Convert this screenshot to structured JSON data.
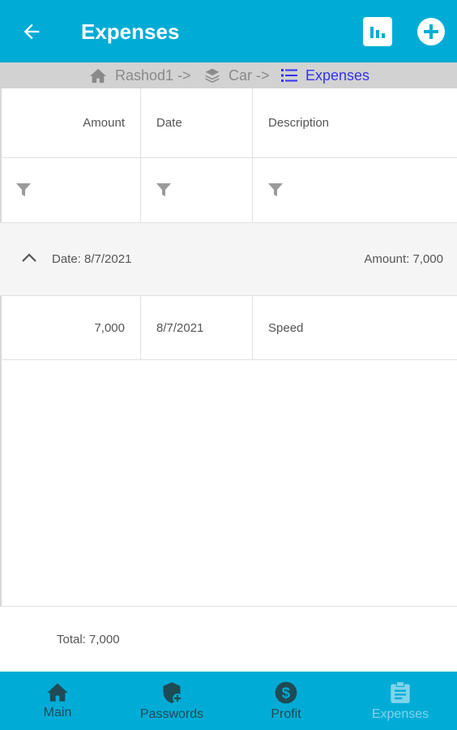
{
  "header": {
    "title": "Expenses",
    "back_icon": "arrow-left-icon",
    "chart_icon": "bar-chart-icon",
    "add_icon": "add-circle-icon",
    "color": "#00acd6"
  },
  "breadcrumb": [
    {
      "label": "Rashod1 ->",
      "icon": "home-icon"
    },
    {
      "label": "Car ->",
      "icon": "layers-icon"
    },
    {
      "label": "Expenses",
      "icon": "list-icon",
      "active_color": "#3333ee"
    }
  ],
  "table": {
    "columns": [
      "Amount",
      "Date",
      "Description"
    ],
    "filter_icon": "filter-icon",
    "group": {
      "label": "Date: 8/7/2021",
      "summary": "Amount: 7,000",
      "expanded_icon": "chevron-up-icon"
    },
    "rows": [
      {
        "amount": "7,000",
        "date": "8/7/2021",
        "description": "Speed"
      }
    ]
  },
  "footer": {
    "total": "Total: 7,000"
  },
  "bottom_nav": [
    {
      "label": "Main",
      "icon": "home-icon"
    },
    {
      "label": "Passwords",
      "icon": "shield-plus-icon"
    },
    {
      "label": "Profit",
      "icon": "dollar-circle-icon"
    },
    {
      "label": "Expenses",
      "icon": "clipboard-icon",
      "current": true
    }
  ]
}
